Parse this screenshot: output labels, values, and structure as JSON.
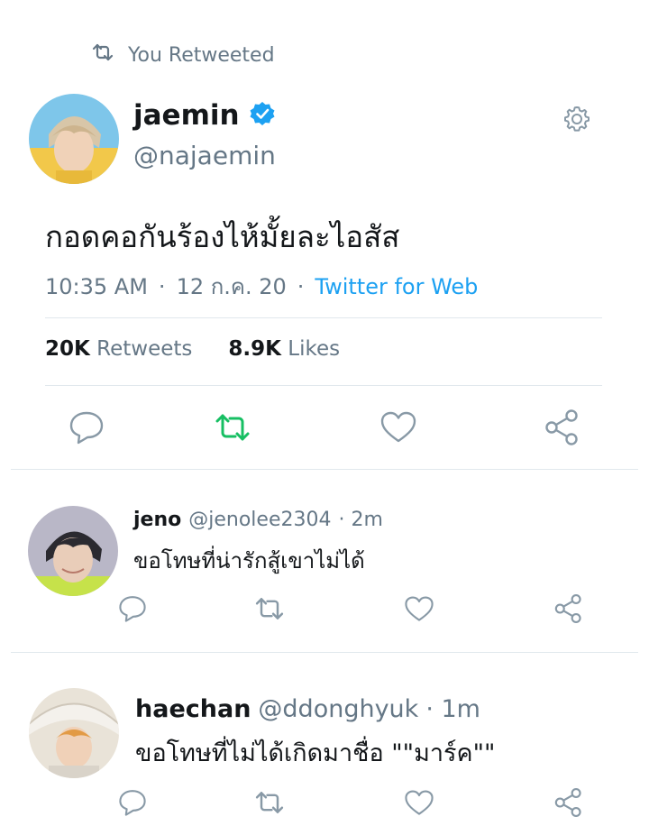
{
  "retweet_header": {
    "label": "You Retweeted"
  },
  "main_tweet": {
    "display_name": "jaemin",
    "handle": "@najaemin",
    "verified": true,
    "text": "กอดคอกันร้องไห้มั้ยละไอสัส",
    "time": "10:35 AM",
    "date": "12 ก.ค. 20",
    "source": "Twitter for Web",
    "retweets_count": "20K",
    "retweets_label": "Retweets",
    "likes_count": "8.9K",
    "likes_label": "Likes",
    "retweeted": true
  },
  "replies": [
    {
      "display_name": "jeno",
      "handle": "@jenolee2304",
      "time": "· 2m",
      "text": "ขอโทษที่น่ารักสู้เขาไม่ได้"
    },
    {
      "display_name": "haechan",
      "handle": "@ddonghyuk",
      "time": "· 1m",
      "text": "ขอโทษที่ไม่ได้เกิดมาชื่อ \"\"มาร์ค\"\""
    }
  ],
  "colors": {
    "accent": "#1da1f2",
    "retweet_green": "#17bf63",
    "muted": "#657786",
    "divider": "#e1e8ed"
  },
  "icons": [
    "retweet-icon",
    "verified-badge-icon",
    "gear-icon",
    "reply-icon",
    "like-icon",
    "share-icon"
  ]
}
